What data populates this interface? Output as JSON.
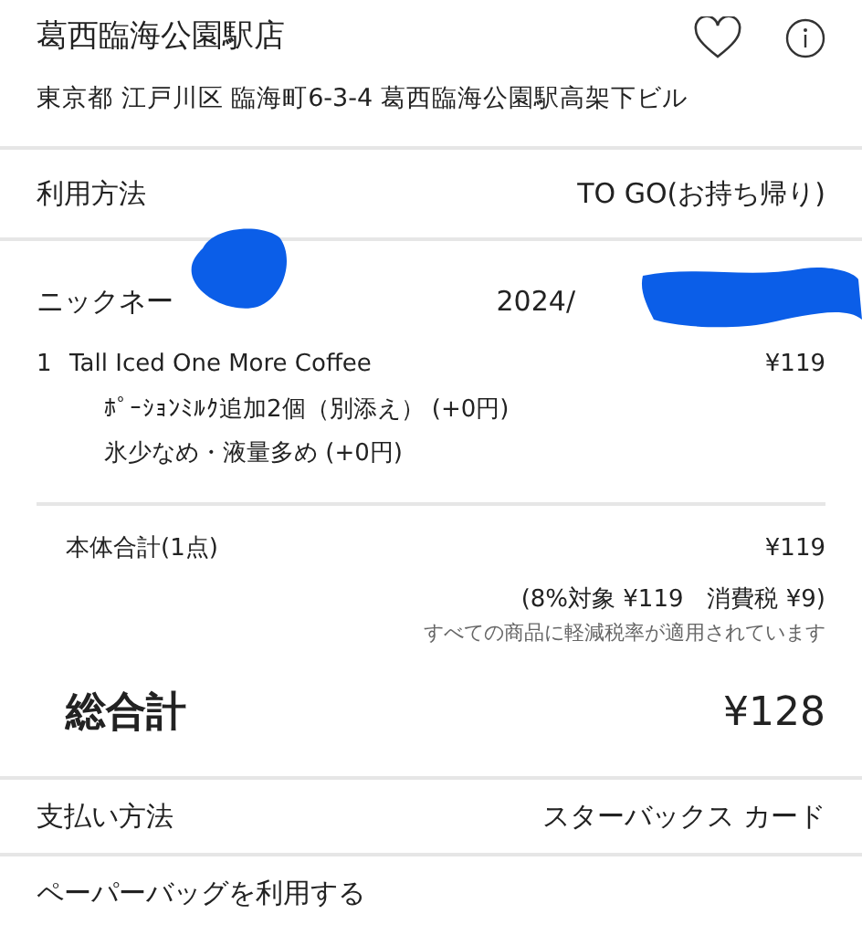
{
  "store": {
    "name": "葛西臨海公園駅店",
    "address": "東京都 江戸川区 臨海町6-3-4 葛西臨海公園駅高架下ビル",
    "favorite": false
  },
  "usage": {
    "label": "利用方法",
    "value": "TO GO(お持ち帰り)"
  },
  "nickname": {
    "label": "ニックネー",
    "date": "2024/"
  },
  "items": [
    {
      "qty": "1",
      "name": "Tall Iced One More Coffee",
      "price": "¥119",
      "options": [
        "ﾎﾟｰｼｮﾝﾐﾙｸ追加2個（別添え） (+0円)",
        "氷少なめ・液量多め (+0円)"
      ]
    }
  ],
  "subtotal": {
    "label": "本体合計(1点)",
    "value": "¥119",
    "tax": "(8%対象 ¥119　消費税 ¥9)",
    "note": "すべての商品に軽減税率が適用されています"
  },
  "total": {
    "label": "総合計",
    "value": "¥128"
  },
  "payment": {
    "label": "支払い方法",
    "value": "スターバックス カード"
  },
  "paper_bag": {
    "label": "ペーパーバッグを利用する"
  }
}
